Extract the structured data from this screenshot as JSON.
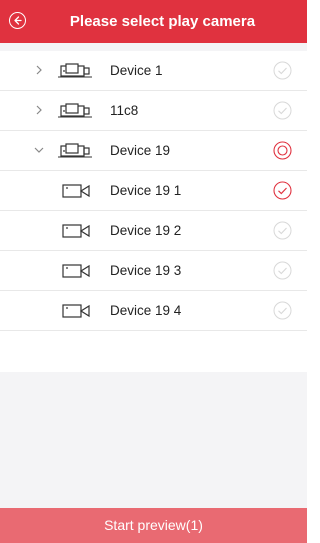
{
  "header": {
    "title": "Please select play camera",
    "back_icon": "back-arrow-circle-icon"
  },
  "colors": {
    "accent": "#e0323f",
    "footer_bg": "#e96a72",
    "muted": "#d8d8d8"
  },
  "devices": [
    {
      "label": "Device 1",
      "expanded": false,
      "state": "unchecked"
    },
    {
      "label": "11c8",
      "expanded": false,
      "state": "unchecked"
    },
    {
      "label": "Device 19",
      "expanded": true,
      "state": "partial"
    }
  ],
  "cameras": [
    {
      "label": "Device 19 1",
      "state": "checked"
    },
    {
      "label": "Device 19 2",
      "state": "unchecked"
    },
    {
      "label": "Device 19 3",
      "state": "unchecked"
    },
    {
      "label": "Device 19 4",
      "state": "unchecked"
    }
  ],
  "footer": {
    "button_label": "Start preview(1)"
  }
}
